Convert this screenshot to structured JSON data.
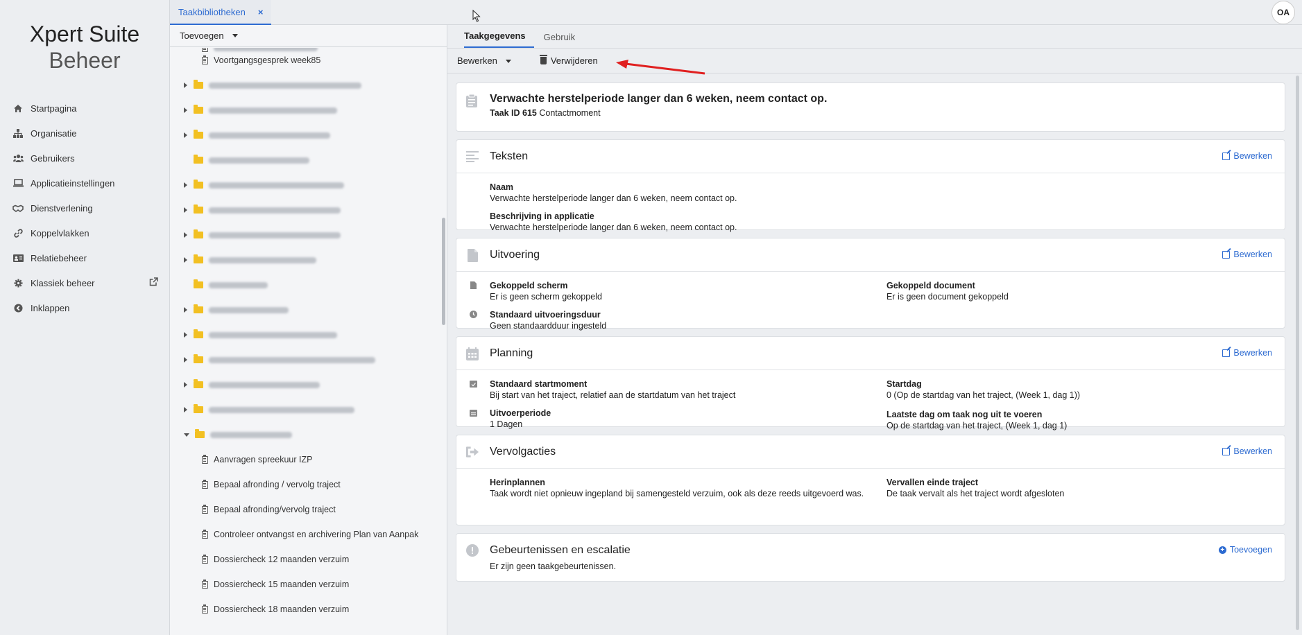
{
  "app": {
    "brand_line1": "Xpert Suite",
    "brand_line2": "Beheer",
    "user_initials": "OA"
  },
  "sidebar": {
    "items": [
      {
        "label": "Startpagina",
        "icon": "home-icon"
      },
      {
        "label": "Organisatie",
        "icon": "sitemap-icon"
      },
      {
        "label": "Gebruikers",
        "icon": "users-icon"
      },
      {
        "label": "Applicatieinstellingen",
        "icon": "laptop-icon"
      },
      {
        "label": "Dienstverlening",
        "icon": "handshake-icon"
      },
      {
        "label": "Koppelvlakken",
        "icon": "link-icon"
      },
      {
        "label": "Relatiebeheer",
        "icon": "id-card-icon"
      },
      {
        "label": "Klassiek beheer",
        "icon": "gear-icon"
      },
      {
        "label": "Inklappen",
        "icon": "arrow-left-circle-icon"
      }
    ]
  },
  "tabbar": {
    "tab_label": "Taakbibliotheken",
    "close_glyph": "×"
  },
  "tree": {
    "toolbar_label": "Toevoegen",
    "top_item": "Voortgangsgesprek week85",
    "leaf_items": [
      "Aanvragen spreekuur IZP",
      "Bepaal afronding / vervolg traject",
      "Bepaal afronding/vervolg traject",
      "Controleer ontvangst en archivering Plan van Aanpak",
      "Dossiercheck 12 maanden verzuim",
      "Dossiercheck 15 maanden verzuim",
      "Dossiercheck 18 maanden verzuim"
    ]
  },
  "detail": {
    "tabs": [
      "Taakgegevens",
      "Gebruik"
    ],
    "toolbar": {
      "edit_label": "Bewerken",
      "delete_label": "Verwijderen"
    },
    "header": {
      "title": "Verwachte herstelperiode langer dan 6 weken, neem contact op.",
      "task_id_label": "Taak ID 615",
      "task_type": "Contactmoment"
    },
    "texts": {
      "title": "Teksten",
      "action": "Bewerken",
      "naam_label": "Naam",
      "naam_value": "Verwachte herstelperiode langer dan 6 weken, neem contact op.",
      "desc_label": "Beschrijving in applicatie",
      "desc_value": "Verwachte herstelperiode langer dan 6 weken, neem contact op."
    },
    "execution": {
      "title": "Uitvoering",
      "action": "Bewerken",
      "screen_label": "Gekoppeld scherm",
      "screen_value": "Er is geen scherm gekoppeld",
      "doc_label": "Gekoppeld document",
      "doc_value": "Er is geen document gekoppeld",
      "duration_label": "Standaard uitvoeringsduur",
      "duration_value": "Geen standaardduur ingesteld"
    },
    "planning": {
      "title": "Planning",
      "action": "Bewerken",
      "start_label": "Standaard startmoment",
      "start_value": "Bij start van het traject, relatief aan de startdatum van het traject",
      "startday_label": "Startdag",
      "startday_value": "0 (Op de startdag van het traject, (Week 1, dag 1))",
      "period_label": "Uitvoerperiode",
      "period_value": "1 Dagen",
      "lastday_label": "Laatste dag om taak nog uit te voeren",
      "lastday_value": "Op de startdag van het traject, (Week 1, dag 1)"
    },
    "followup": {
      "title": "Vervolgacties",
      "action": "Bewerken",
      "replan_label": "Herinplannen",
      "replan_value": "Taak wordt niet opnieuw ingepland bij samengesteld verzuim, ook als deze reeds uitgevoerd was.",
      "expire_label": "Vervallen einde traject",
      "expire_value": "De taak vervalt als het traject wordt afgesloten"
    },
    "events": {
      "title": "Gebeurtenissen en escalatie",
      "action": "Toevoegen",
      "empty": "Er zijn geen taakgebeurtenissen."
    }
  },
  "colors": {
    "accent": "#2d6bd1",
    "folder": "#f2c022",
    "annotation_arrow": "#e02020"
  }
}
